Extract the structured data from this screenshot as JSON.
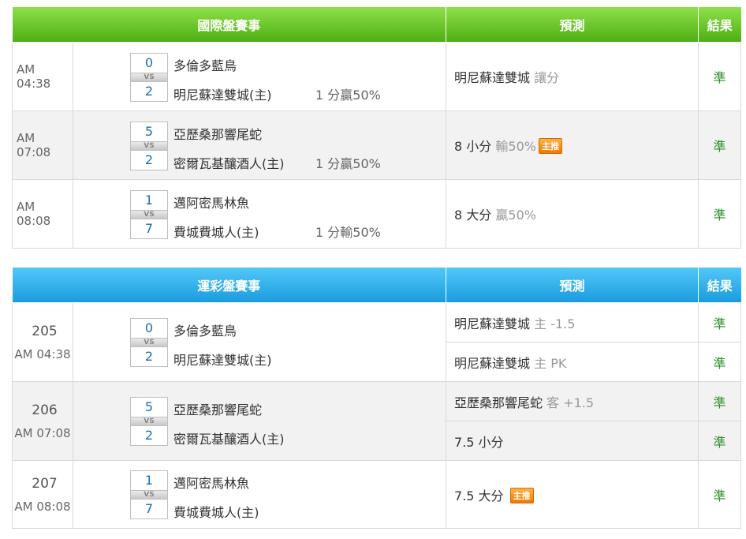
{
  "intl": {
    "header": {
      "title": "國際盤賽事",
      "prediction": "預測",
      "result": "結果"
    },
    "rows": [
      {
        "time": "AM 04:38",
        "away_score": "0",
        "home_score": "2",
        "away": "多倫多藍鳥",
        "home": "明尼蘇達雙城(主)",
        "line": "1 分贏50%",
        "pick": "明尼蘇達雙城",
        "pick_sub": "讓分",
        "badge": "",
        "result": "準"
      },
      {
        "time": "AM 07:08",
        "away_score": "5",
        "home_score": "2",
        "away": "亞歷桑那響尾蛇",
        "home": "密爾瓦基釀酒人(主)",
        "line": "1 分贏50%",
        "pick": "8 小分",
        "pick_sub": "輸50%",
        "badge": "主推",
        "result": "準"
      },
      {
        "time": "AM 08:08",
        "away_score": "1",
        "home_score": "7",
        "away": "邁阿密馬林魚",
        "home": "費城費城人(主)",
        "line": "1 分輸50%",
        "pick": "8 大分",
        "pick_sub": "贏50%",
        "badge": "",
        "result": "準"
      }
    ]
  },
  "sport": {
    "header": {
      "title": "運彩盤賽事",
      "prediction": "預測",
      "result": "結果"
    },
    "rows": [
      {
        "num": "205",
        "time": "AM 04:38",
        "away_score": "0",
        "home_score": "2",
        "away": "多倫多藍鳥",
        "home": "明尼蘇達雙城(主)",
        "picks": [
          {
            "pick": "明尼蘇達雙城",
            "pick_sub": "主 -1.5",
            "badge": "",
            "result": "準"
          },
          {
            "pick": "明尼蘇達雙城",
            "pick_sub": "主 PK",
            "badge": "",
            "result": "準"
          }
        ]
      },
      {
        "num": "206",
        "time": "AM 07:08",
        "away_score": "5",
        "home_score": "2",
        "away": "亞歷桑那響尾蛇",
        "home": "密爾瓦基釀酒人(主)",
        "picks": [
          {
            "pick": "亞歷桑那響尾蛇",
            "pick_sub": "客 +1.5",
            "badge": "",
            "result": "準"
          },
          {
            "pick": "7.5 小分",
            "pick_sub": "",
            "badge": "",
            "result": "準"
          }
        ]
      },
      {
        "num": "207",
        "time": "AM 08:08",
        "away_score": "1",
        "home_score": "7",
        "away": "邁阿密馬林魚",
        "home": "費城費城人(主)",
        "picks": [
          {
            "pick": "7.5 大分",
            "pick_sub": "",
            "badge": "主推",
            "result": "準"
          }
        ]
      }
    ]
  },
  "vs_label": "VS"
}
